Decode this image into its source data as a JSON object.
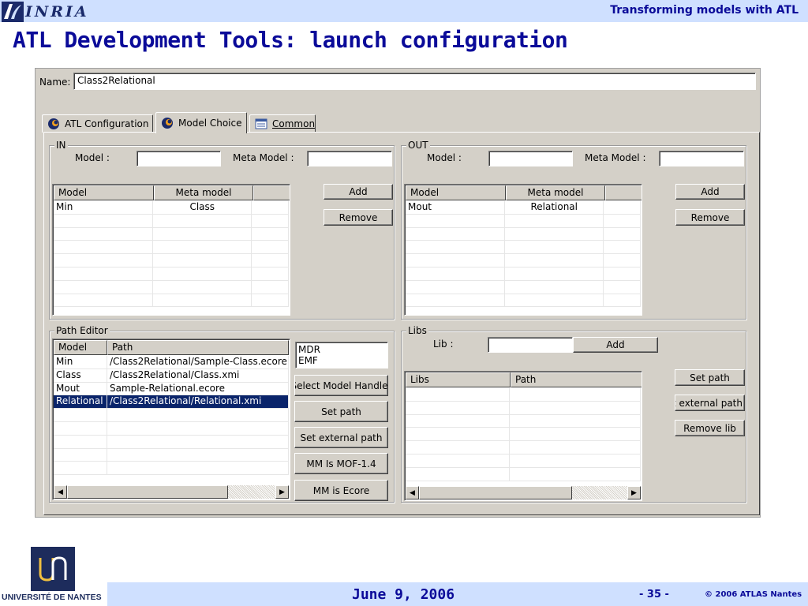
{
  "header": {
    "logo_text": "INRIA",
    "right_text": "Transforming models with ATL",
    "slide_title": "ATL Development Tools: launch configuration"
  },
  "dialog": {
    "name_label": "Name:",
    "name_value": "Class2Relational",
    "tabs": [
      {
        "label": "ATL Configuration",
        "icon": "atl-icon"
      },
      {
        "label": "Model Choice",
        "icon": "atl-icon",
        "selected": true
      },
      {
        "label": "Common",
        "icon": "common-icon"
      }
    ],
    "in_group": {
      "title": "IN",
      "model_label": "Model :",
      "model_value": "",
      "meta_model_label": "Meta Model :",
      "meta_model_value": "",
      "columns": [
        "Model",
        "Meta model"
      ],
      "rows": [
        {
          "model": "Min",
          "meta": "Class"
        }
      ],
      "add_label": "Add",
      "remove_label": "Remove"
    },
    "out_group": {
      "title": "OUT",
      "model_label": "Model :",
      "model_value": "",
      "meta_model_label": "Meta Model :",
      "meta_model_value": "",
      "columns": [
        "Model",
        "Meta model"
      ],
      "rows": [
        {
          "model": "Mout",
          "meta": "Relational"
        }
      ],
      "add_label": "Add",
      "remove_label": "Remove"
    },
    "path_editor": {
      "title": "Path Editor",
      "columns": [
        "Model",
        "Path"
      ],
      "rows": [
        {
          "model": "Min",
          "path": "/Class2Relational/Sample-Class.ecore"
        },
        {
          "model": "Class",
          "path": "/Class2Relational/Class.xmi"
        },
        {
          "model": "Mout",
          "path": "Sample-Relational.ecore"
        },
        {
          "model": "Relational",
          "path": "/Class2Relational/Relational.xmi",
          "selected": true
        }
      ],
      "handlers": [
        "MDR",
        "EMF"
      ],
      "buttons": {
        "select_handler": "Select Model Handler",
        "set_path": "Set path",
        "set_external_path": "Set external path",
        "mm_mof": "MM Is MOF-1.4",
        "mm_ecore": "MM is Ecore"
      }
    },
    "libs": {
      "title": "Libs",
      "lib_label": "Lib :",
      "lib_value": "",
      "add_label": "Add",
      "columns": [
        "Libs",
        "Path"
      ],
      "buttons": {
        "set_path": "Set path",
        "set_external_path": "Set external path",
        "remove_lib": "Remove lib"
      }
    }
  },
  "footer": {
    "university": "UNIVERSITÉ DE NANTES",
    "date": "June 9, 2006",
    "page": "- 35 -",
    "copyright": "© 2006 ATLAS Nantes"
  },
  "colors": {
    "slide_bar": "#cfe0ff",
    "title_blue": "#0b0b99",
    "dialog_bg": "#d4d0c8",
    "selection": "#0a246a"
  }
}
